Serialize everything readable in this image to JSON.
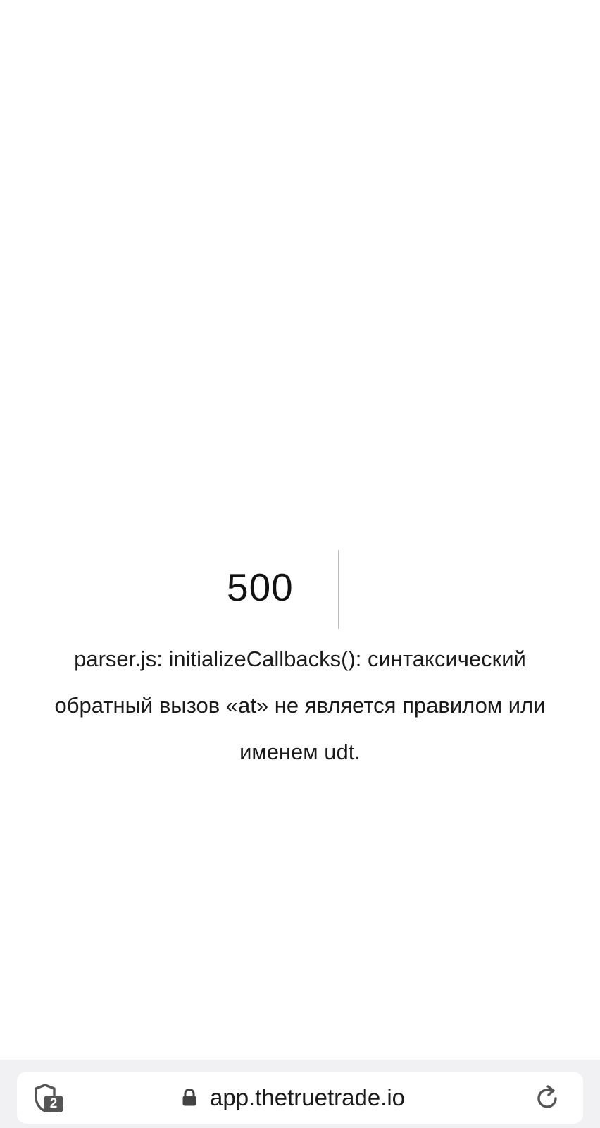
{
  "error": {
    "code": "500",
    "message": "parser.js: initializeCallbacks(): синтаксический обратный вызов «at» не является правилом или именем udt."
  },
  "browser_bar": {
    "tracker_count": "2",
    "url": "app.thetruetrade.io",
    "icons": {
      "shield": "shield-icon",
      "lock": "lock-icon",
      "reload": "reload-icon"
    },
    "colors": {
      "bar_background": "#f1f1f3",
      "pill_background": "#ffffff",
      "icon": "#555555"
    }
  }
}
